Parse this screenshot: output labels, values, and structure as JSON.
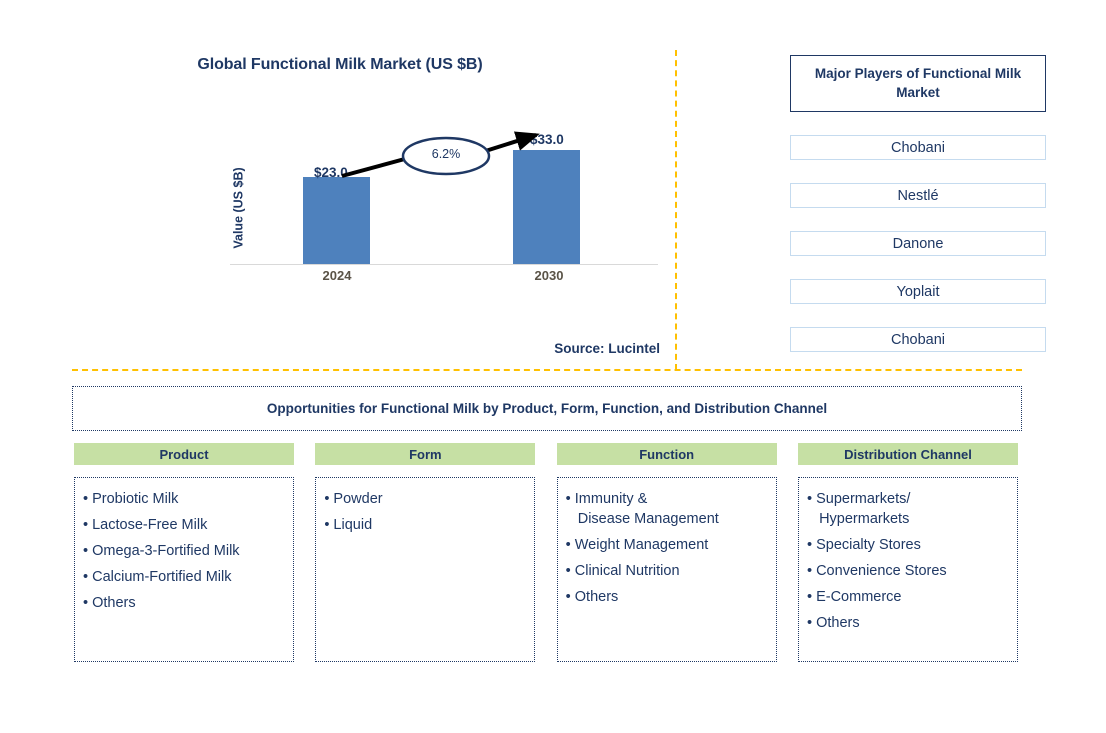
{
  "chart_panel": {
    "title": "Global Functional Milk Market (US $B)",
    "y_axis_label": "Value (US $B)",
    "source": "Source: Lucintel"
  },
  "chart_data": {
    "type": "bar",
    "title": "Global Functional Milk Market (US $B)",
    "xlabel": "",
    "ylabel": "Value (US $B)",
    "categories": [
      "2024",
      "2030"
    ],
    "values": [
      23.0,
      33.0
    ],
    "value_labels": [
      "$23.0",
      "$33.0"
    ],
    "ylim": [
      0,
      38
    ],
    "grid": false,
    "legend": "none",
    "annotation": {
      "label": "6.2%",
      "type": "cagr-callout",
      "shape": "ellipse-with-arrow",
      "from": "2024",
      "to": "2030"
    },
    "bar_color": "#4E81BD"
  },
  "players": {
    "header": "Major Players of Functional Milk Market",
    "items": [
      {
        "name": "Chobani"
      },
      {
        "name": "Nestlé"
      },
      {
        "name": "Danone"
      },
      {
        "name": "Yoplait"
      },
      {
        "name": "Chobani"
      }
    ]
  },
  "opportunities": {
    "banner": "Opportunities for Functional Milk by Product, Form, Function, and Distribution Channel",
    "columns": [
      {
        "header": "Product",
        "items": [
          "Probiotic Milk",
          "Lactose-Free Milk",
          "Omega-3-Fortified Milk",
          "Calcium-Fortified Milk",
          "Others"
        ]
      },
      {
        "header": "Form",
        "items": [
          "Powder",
          "Liquid"
        ]
      },
      {
        "header": "Function",
        "items": [
          "Immunity &\nDisease Management",
          " Weight Management",
          "Clinical Nutrition",
          "Others"
        ]
      },
      {
        "header": "Distribution Channel",
        "items": [
          "Supermarkets/\nHypermarkets",
          "Specialty Stores",
          "Convenience Stores",
          "E-Commerce",
          "Others"
        ]
      }
    ]
  },
  "colors": {
    "bar": "#4E81BD",
    "navy": "#1F3864",
    "gold_divider": "#FFC000",
    "green_header": "#C6E0A4",
    "player_border": "#C5DBEF"
  }
}
